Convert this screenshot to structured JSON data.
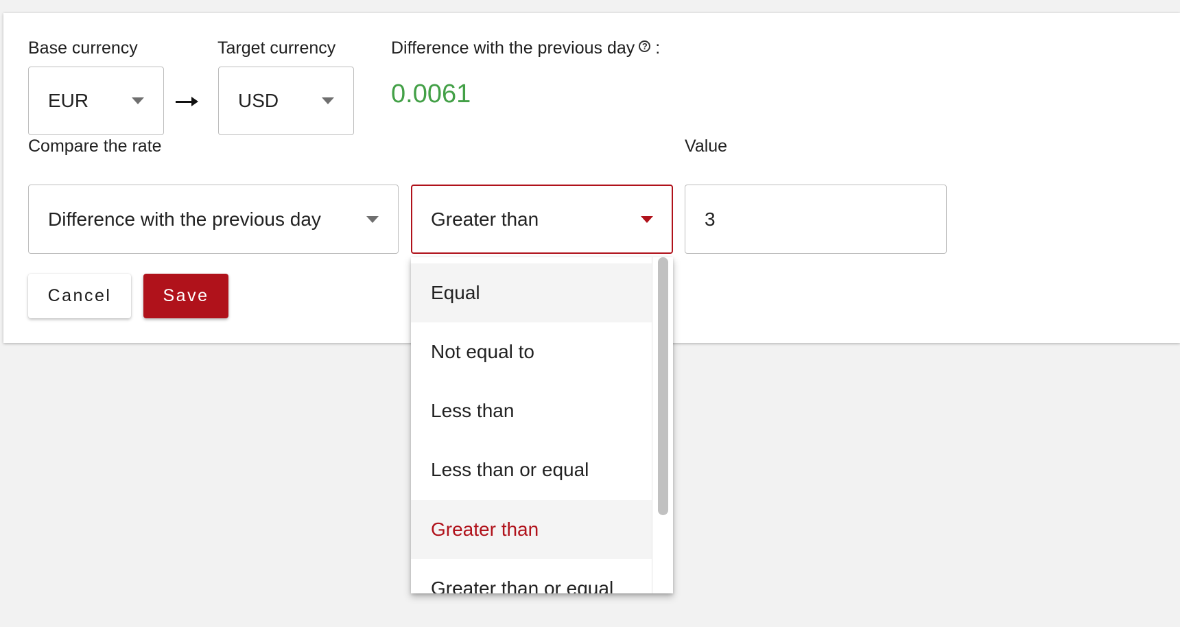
{
  "form": {
    "base_currency_label": "Base currency",
    "base_currency_value": "EUR",
    "target_currency_label": "Target currency",
    "target_currency_value": "USD",
    "difference_label": "Difference with the previous day",
    "difference_colon": ":",
    "difference_value": "0.0061",
    "compare_label": "Compare the rate",
    "compare_value": "Difference with the previous day",
    "operator_value": "Greater than",
    "value_label": "Value",
    "value_value": "3"
  },
  "buttons": {
    "cancel": "Cancel",
    "save": "Save"
  },
  "operator_dropdown": {
    "options": [
      {
        "label": "Equal",
        "state": "hover"
      },
      {
        "label": "Not equal to",
        "state": "normal"
      },
      {
        "label": "Less than",
        "state": "normal"
      },
      {
        "label": "Less than or equal",
        "state": "normal"
      },
      {
        "label": "Greater than",
        "state": "selected"
      },
      {
        "label": "Greater than or equal",
        "state": "normal"
      }
    ]
  },
  "colors": {
    "accent": "#b0121b",
    "positive": "#43a047"
  },
  "icons": {
    "help": "question-circle-icon",
    "caret": "caret-down-icon",
    "arrow": "arrow-right-icon"
  }
}
